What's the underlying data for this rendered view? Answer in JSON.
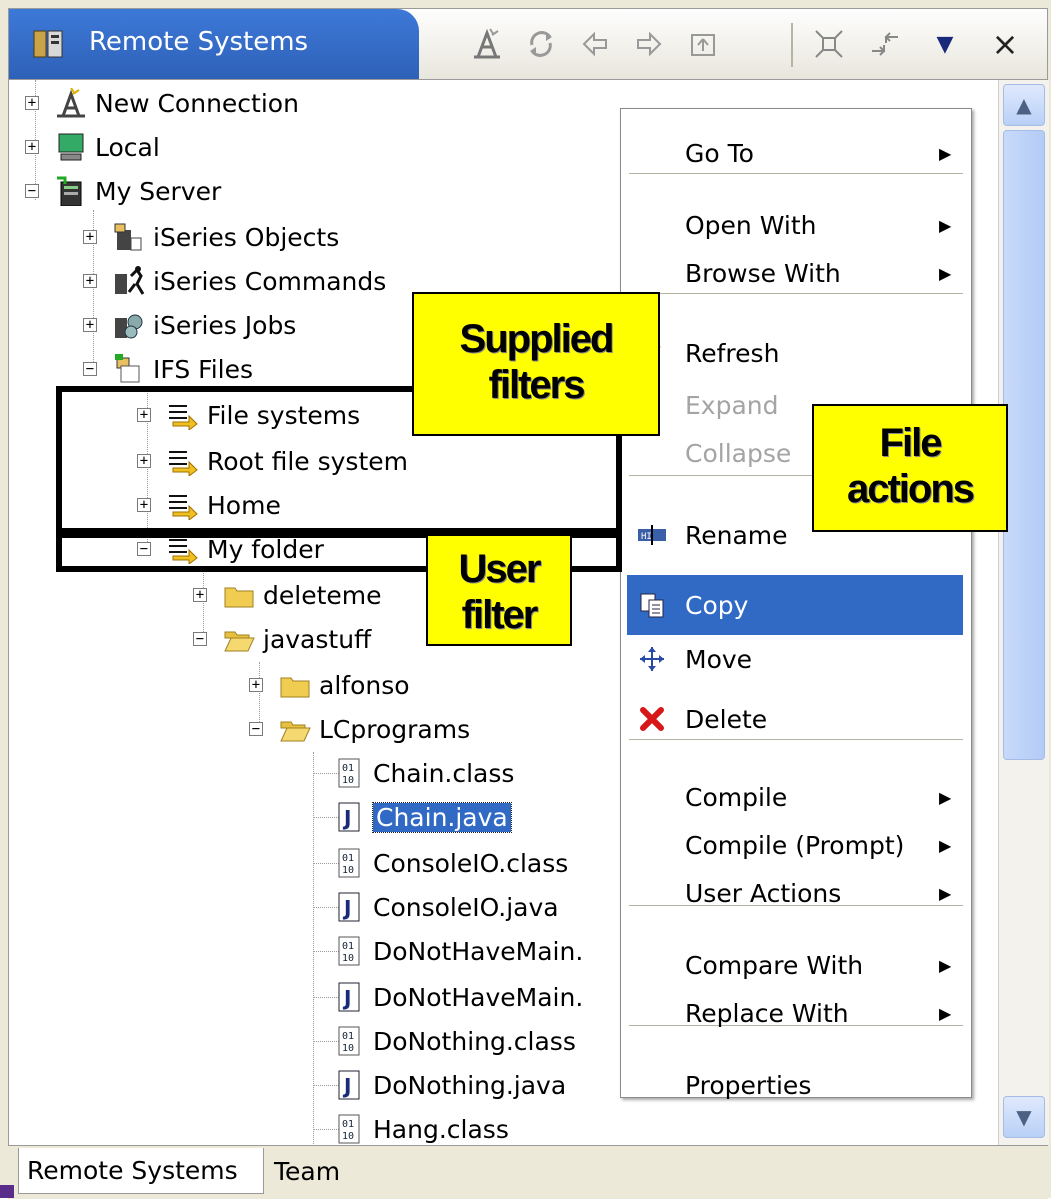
{
  "window": {
    "title": "Remote Systems"
  },
  "toolbar": {
    "icons": [
      "new-connection-icon",
      "refresh-icon",
      "back-icon",
      "forward-icon",
      "up-icon",
      "collapse-all-icon",
      "link-icon",
      "view-menu-icon",
      "close-icon"
    ],
    "close": "×",
    "menu": "▼"
  },
  "tree": {
    "items": [
      {
        "label": "New Connection",
        "icon": "new-connection-icon",
        "expander": "+"
      },
      {
        "label": "Local",
        "icon": "local-computer-icon",
        "expander": "+"
      },
      {
        "label": "My Server",
        "icon": "server-icon",
        "expander": "−"
      },
      {
        "label": "iSeries Objects",
        "icon": "iseries-objects-icon",
        "expander": "+"
      },
      {
        "label": "iSeries Commands",
        "icon": "iseries-commands-icon",
        "expander": "+"
      },
      {
        "label": "iSeries Jobs",
        "icon": "iseries-jobs-icon",
        "expander": "+"
      },
      {
        "label": "IFS Files",
        "icon": "ifs-files-icon",
        "expander": "−"
      },
      {
        "label": "File systems",
        "icon": "filter-icon",
        "expander": "+"
      },
      {
        "label": "Root file system",
        "icon": "filter-icon",
        "expander": "+"
      },
      {
        "label": "Home",
        "icon": "filter-icon",
        "expander": "+"
      },
      {
        "label": "My folder",
        "icon": "filter-icon",
        "expander": "−"
      },
      {
        "label": "deleteme",
        "icon": "folder-icon",
        "expander": "+"
      },
      {
        "label": "javastuff",
        "icon": "open-folder-icon",
        "expander": "−"
      },
      {
        "label": "alfonso",
        "icon": "folder-icon",
        "expander": "+"
      },
      {
        "label": "LCprograms",
        "icon": "open-folder-icon",
        "expander": "−"
      },
      {
        "label": "Chain.class",
        "icon": "class-file-icon"
      },
      {
        "label": "Chain.java",
        "icon": "java-file-icon",
        "selected": true
      },
      {
        "label": "ConsoleIO.class",
        "icon": "class-file-icon"
      },
      {
        "label": "ConsoleIO.java",
        "icon": "java-file-icon"
      },
      {
        "label": "DoNotHaveMain.",
        "icon": "class-file-icon"
      },
      {
        "label": "DoNotHaveMain.",
        "icon": "java-file-icon"
      },
      {
        "label": "DoNothing.class",
        "icon": "class-file-icon"
      },
      {
        "label": "DoNothing.java",
        "icon": "java-file-icon"
      },
      {
        "label": "Hang.class",
        "icon": "class-file-icon"
      }
    ]
  },
  "menu": {
    "items": [
      {
        "label": "Go To",
        "submenu": true
      },
      {
        "label": "Open With",
        "submenu": true
      },
      {
        "label": "Browse With",
        "submenu": true
      },
      {
        "label": "Refresh",
        "icon": "refresh-icon"
      },
      {
        "label": "Expand",
        "disabled": true
      },
      {
        "label": "Collapse",
        "disabled": true
      },
      {
        "label": "Rename",
        "icon": "rename-icon"
      },
      {
        "label": "Copy",
        "icon": "copy-icon",
        "highlighted": true
      },
      {
        "label": "Move",
        "icon": "move-icon"
      },
      {
        "label": "Delete",
        "icon": "delete-icon"
      },
      {
        "label": "Compile",
        "submenu": true
      },
      {
        "label": "Compile (Prompt)",
        "submenu": true
      },
      {
        "label": "User Actions",
        "submenu": true
      },
      {
        "label": "Compare With",
        "submenu": true
      },
      {
        "label": "Replace With",
        "submenu": true
      },
      {
        "label": "Properties"
      }
    ],
    "submenu_arrow": "▶"
  },
  "callouts": {
    "supplied_filters": [
      "Supplied",
      "filters"
    ],
    "user_filter": [
      "User",
      "filter"
    ],
    "file_actions": [
      "File",
      "actions"
    ]
  },
  "bottom_tabs": [
    "Remote Systems",
    "Team"
  ],
  "colors": {
    "selection": "#316ac5",
    "callout": "#ffff00",
    "title": "#2e61b8"
  }
}
